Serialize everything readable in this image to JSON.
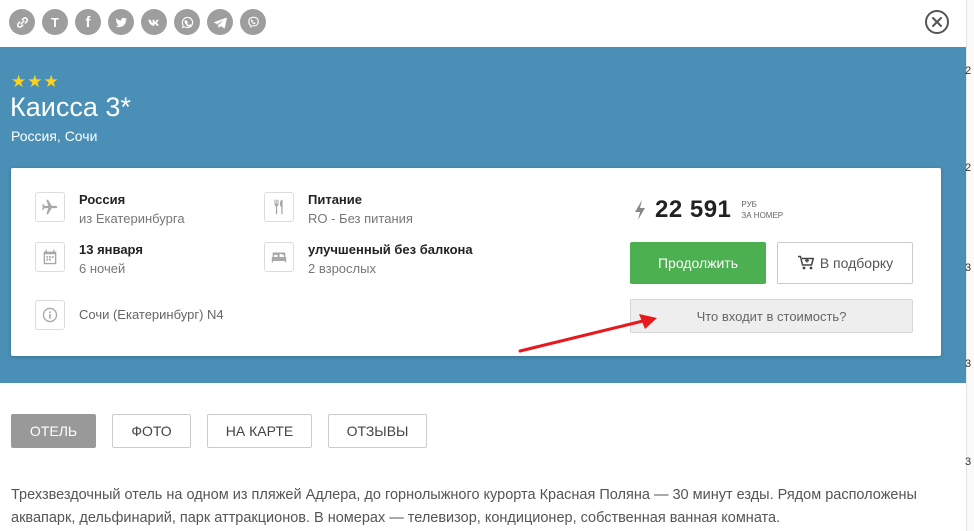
{
  "share": {
    "items": [
      {
        "name": "link-icon",
        "glyph": ""
      },
      {
        "name": "t-letter-icon",
        "glyph": "T"
      },
      {
        "name": "facebook-icon",
        "glyph": "f"
      },
      {
        "name": "twitter-icon",
        "glyph": ""
      },
      {
        "name": "vk-icon",
        "glyph": ""
      },
      {
        "name": "whatsapp-icon",
        "glyph": ""
      },
      {
        "name": "telegram-icon",
        "glyph": ""
      },
      {
        "name": "viber-icon",
        "glyph": ""
      }
    ]
  },
  "hotel": {
    "stars": "★★★",
    "title": "Каисса 3*",
    "location": "Россия, Сочи"
  },
  "offer": {
    "destination": {
      "title": "Россия",
      "sub": "из Екатеринбурга"
    },
    "meal": {
      "title": "Питание",
      "sub": "RO - Без питания"
    },
    "date": {
      "title": "13 января",
      "sub": "6 ночей"
    },
    "room": {
      "title": "улучшенный без балкона",
      "sub": "2 взрослых"
    },
    "flight": {
      "text": "Сочи (Екатеринбург) N4"
    },
    "price": {
      "value": "22 591",
      "currency": "РУБ",
      "per": "ЗА НОМЕР"
    },
    "continue_label": "Продолжить",
    "favorites_label": "В подборку",
    "included_label": "Что входит в стоимость?"
  },
  "tabs": [
    {
      "label": "ОТЕЛЬ",
      "active": true
    },
    {
      "label": "ФОТО",
      "active": false
    },
    {
      "label": "НА КАРТЕ",
      "active": false
    },
    {
      "label": "ОТЗЫВЫ",
      "active": false
    }
  ],
  "description": "Трехзвездочный отель на одном из пляжей Адлера, до горнолыжного курорта Красная Поляна — 30 минут езды. Рядом расположены аквапарк, дельфинарий, парк аттракционов. В номерах — телевизор, кондиционер, собственная ванная комната.",
  "edge_numbers": [
    "2",
    "2",
    "3",
    "3",
    "3"
  ],
  "colors": {
    "hero_bg": "#4a8fb5",
    "star": "#ffd21a",
    "continue_bg": "#4caf50",
    "annotation_arrow": "#e8191c"
  }
}
